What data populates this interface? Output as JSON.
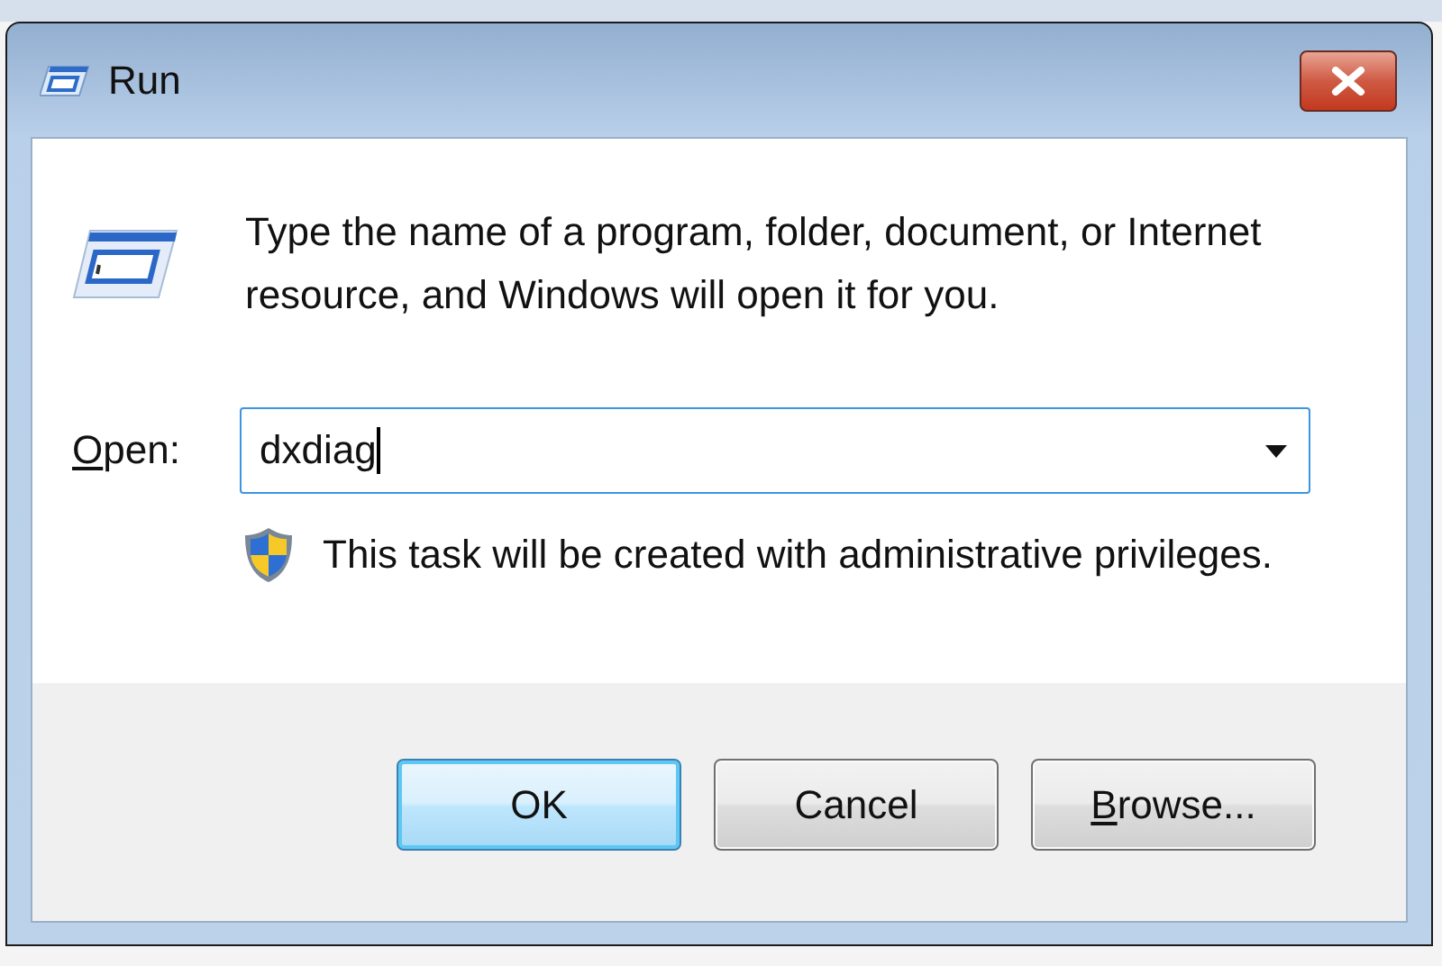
{
  "window": {
    "title": "Run"
  },
  "message_lines": [
    "Type the name of a program, folder, document, or Internet",
    "resource, and Windows will open it for you."
  ],
  "open_field": {
    "label": {
      "access_key": "O",
      "rest": "pen:"
    },
    "value": "dxdiag",
    "focused": true
  },
  "notice": "This task will be created with administrative privileges.",
  "buttons": [
    {
      "label": "OK",
      "default": true
    },
    {
      "label": "Cancel",
      "default": false
    },
    {
      "access_key": "B",
      "label": "rowse...",
      "default": false
    }
  ]
}
